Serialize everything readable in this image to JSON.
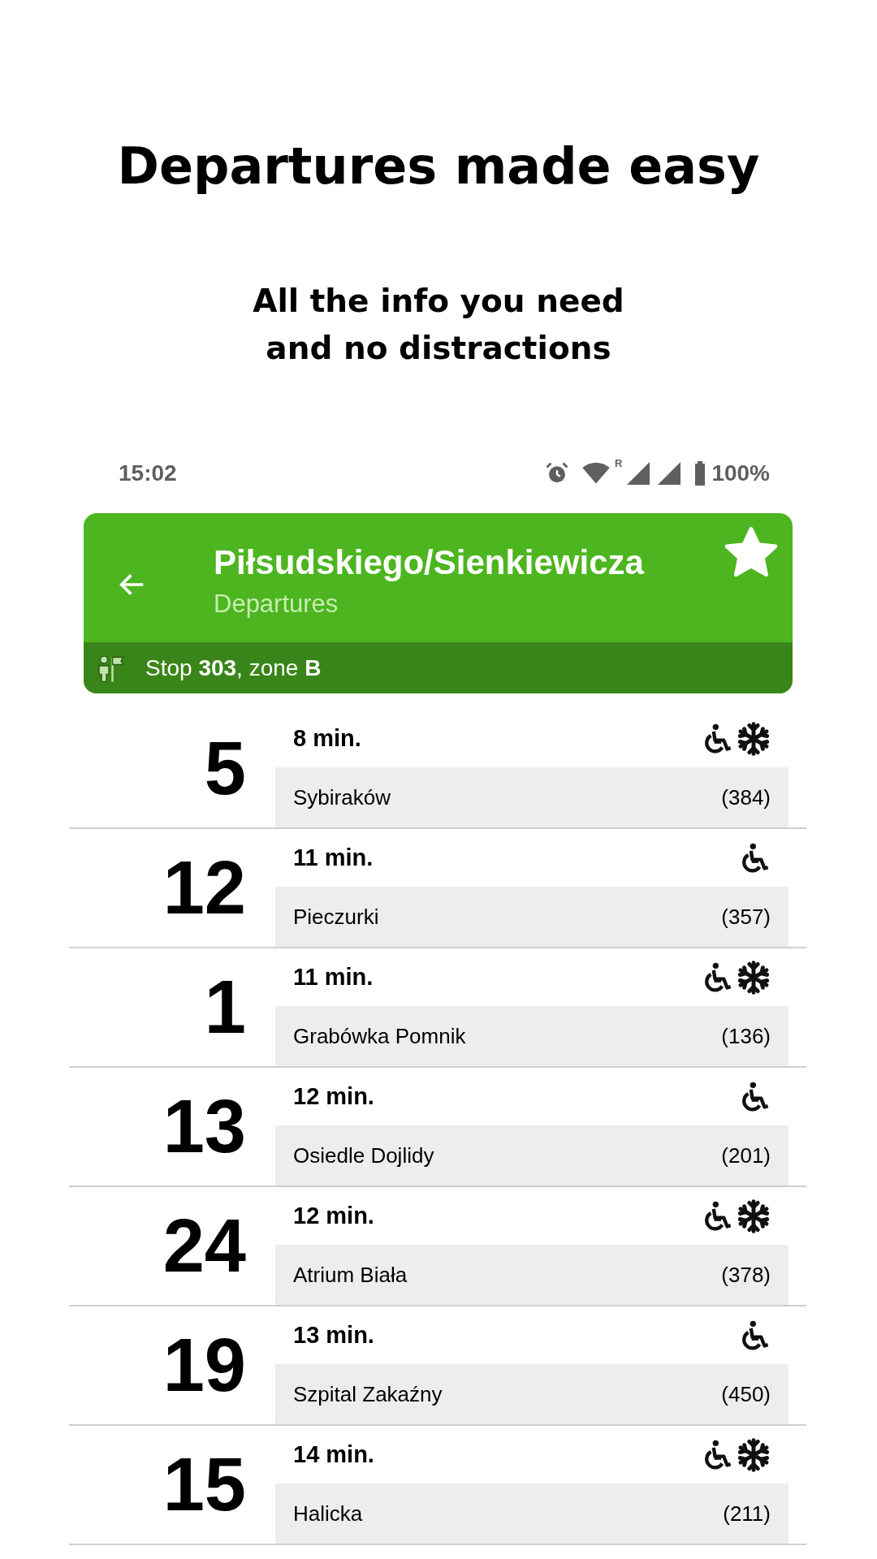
{
  "headline": "Departures made easy",
  "subheadline": "All the info you need\nand no distractions",
  "status_bar": {
    "time": "15:02",
    "roaming": "R",
    "battery": "100%"
  },
  "app_bar": {
    "title": "Piłsudskiego/Sienkiewicza",
    "subtitle": "Departures",
    "favorite": true,
    "stop_info": "Stop **303**, zone **B**"
  },
  "departures": [
    {
      "route": "5",
      "time": "8 min.",
      "destination": "Sybiraków",
      "vehicle": "(384)",
      "accessible": true,
      "air_conditioned": true
    },
    {
      "route": "12",
      "time": "11 min.",
      "destination": "Pieczurki",
      "vehicle": "(357)",
      "accessible": true,
      "air_conditioned": false
    },
    {
      "route": "1",
      "time": "11 min.",
      "destination": "Grabówka Pomnik",
      "vehicle": "(136)",
      "accessible": true,
      "air_conditioned": true
    },
    {
      "route": "13",
      "time": "12 min.",
      "destination": "Osiedle Dojlidy",
      "vehicle": "(201)",
      "accessible": true,
      "air_conditioned": false
    },
    {
      "route": "24",
      "time": "12 min.",
      "destination": "Atrium Biała",
      "vehicle": "(378)",
      "accessible": true,
      "air_conditioned": true
    },
    {
      "route": "19",
      "time": "13 min.",
      "destination": "Szpital Zakaźny",
      "vehicle": "(450)",
      "accessible": true,
      "air_conditioned": false
    },
    {
      "route": "15",
      "time": "14 min.",
      "destination": "Halicka",
      "vehicle": "(211)",
      "accessible": true,
      "air_conditioned": true
    }
  ]
}
